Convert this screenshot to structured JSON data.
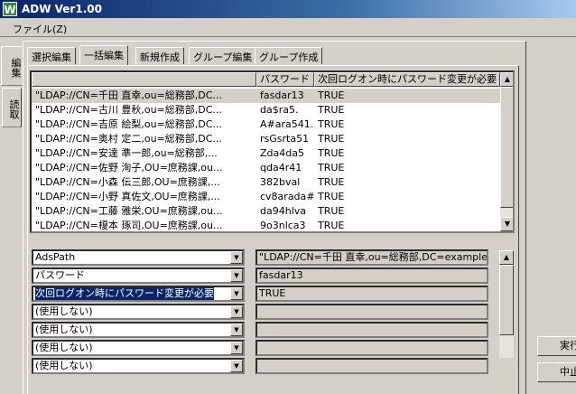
{
  "window": {
    "title": "ADW Ver1.00",
    "icon_letter": "W"
  },
  "menu": {
    "file": "ファイル(Z)"
  },
  "side_tabs": [
    "編集",
    "読取"
  ],
  "tabs": [
    "選択編集",
    "一括編集",
    "新規作成",
    "グループ編集",
    "グループ作成"
  ],
  "active_tab": 1,
  "table": {
    "columns": [
      "",
      "パスワード",
      "次回ログオン時にパスワード変更が必要"
    ],
    "rows": [
      [
        "\"LDAP://CN=千田 直幸,ou=総務部,DC...",
        "fasdar13",
        "TRUE"
      ],
      [
        "\"LDAP://CN=古川 豊秋,ou=総務部,DC...",
        "da$ra5.",
        "TRUE"
      ],
      [
        "\"LDAP://CN=吉原 絵梨,ou=総務部,DC...",
        "A#ara541.",
        "TRUE"
      ],
      [
        "\"LDAP://CN=奥村 定二,ou=総務部,DC...",
        "rsGsrta51",
        "TRUE"
      ],
      [
        "\"LDAP://CN=安達 準一郎,ou=総務部,...",
        "Zda4da5",
        "TRUE"
      ],
      [
        "\"LDAP://CN=佐野 洵子,OU=庶務課,ou...",
        "qda4r41",
        "TRUE"
      ],
      [
        "\"LDAP://CN=小森 伝三郎,OU=庶務課,...",
        "382bval",
        "TRUE"
      ],
      [
        "\"LDAP://CN=小野 真佐文,OU=庶務課,...",
        "cv8arada#",
        "TRUE"
      ],
      [
        "\"LDAP://CN=工藤 雅栄,OU=庶務課,ou...",
        "da94hlva",
        "TRUE"
      ],
      [
        "\"LDAP://CN=榎本 琢司,OU=庶務課,ou...",
        "9o3nlca3",
        "TRUE"
      ]
    ],
    "selected_row": 0
  },
  "mapping": [
    {
      "select": "AdsPath",
      "value": "\"LDAP://CN=千田 直幸,ou=総務部,DC=example,D"
    },
    {
      "select": "パスワード",
      "value": "fasdar13"
    },
    {
      "select": "次回ログオン時にパスワード変更が必要",
      "value": "TRUE"
    },
    {
      "select": "(使用しない)",
      "value": ""
    },
    {
      "select": "(使用しない)",
      "value": ""
    },
    {
      "select": "(使用しない)",
      "value": ""
    },
    {
      "select": "(使用しない)",
      "value": ""
    }
  ],
  "buttons": {
    "execute": "実行",
    "stop": "中止"
  },
  "colors": {
    "titlebar": "#0a246a",
    "face": "#d4d0c8",
    "highlight": "#0a246a"
  }
}
